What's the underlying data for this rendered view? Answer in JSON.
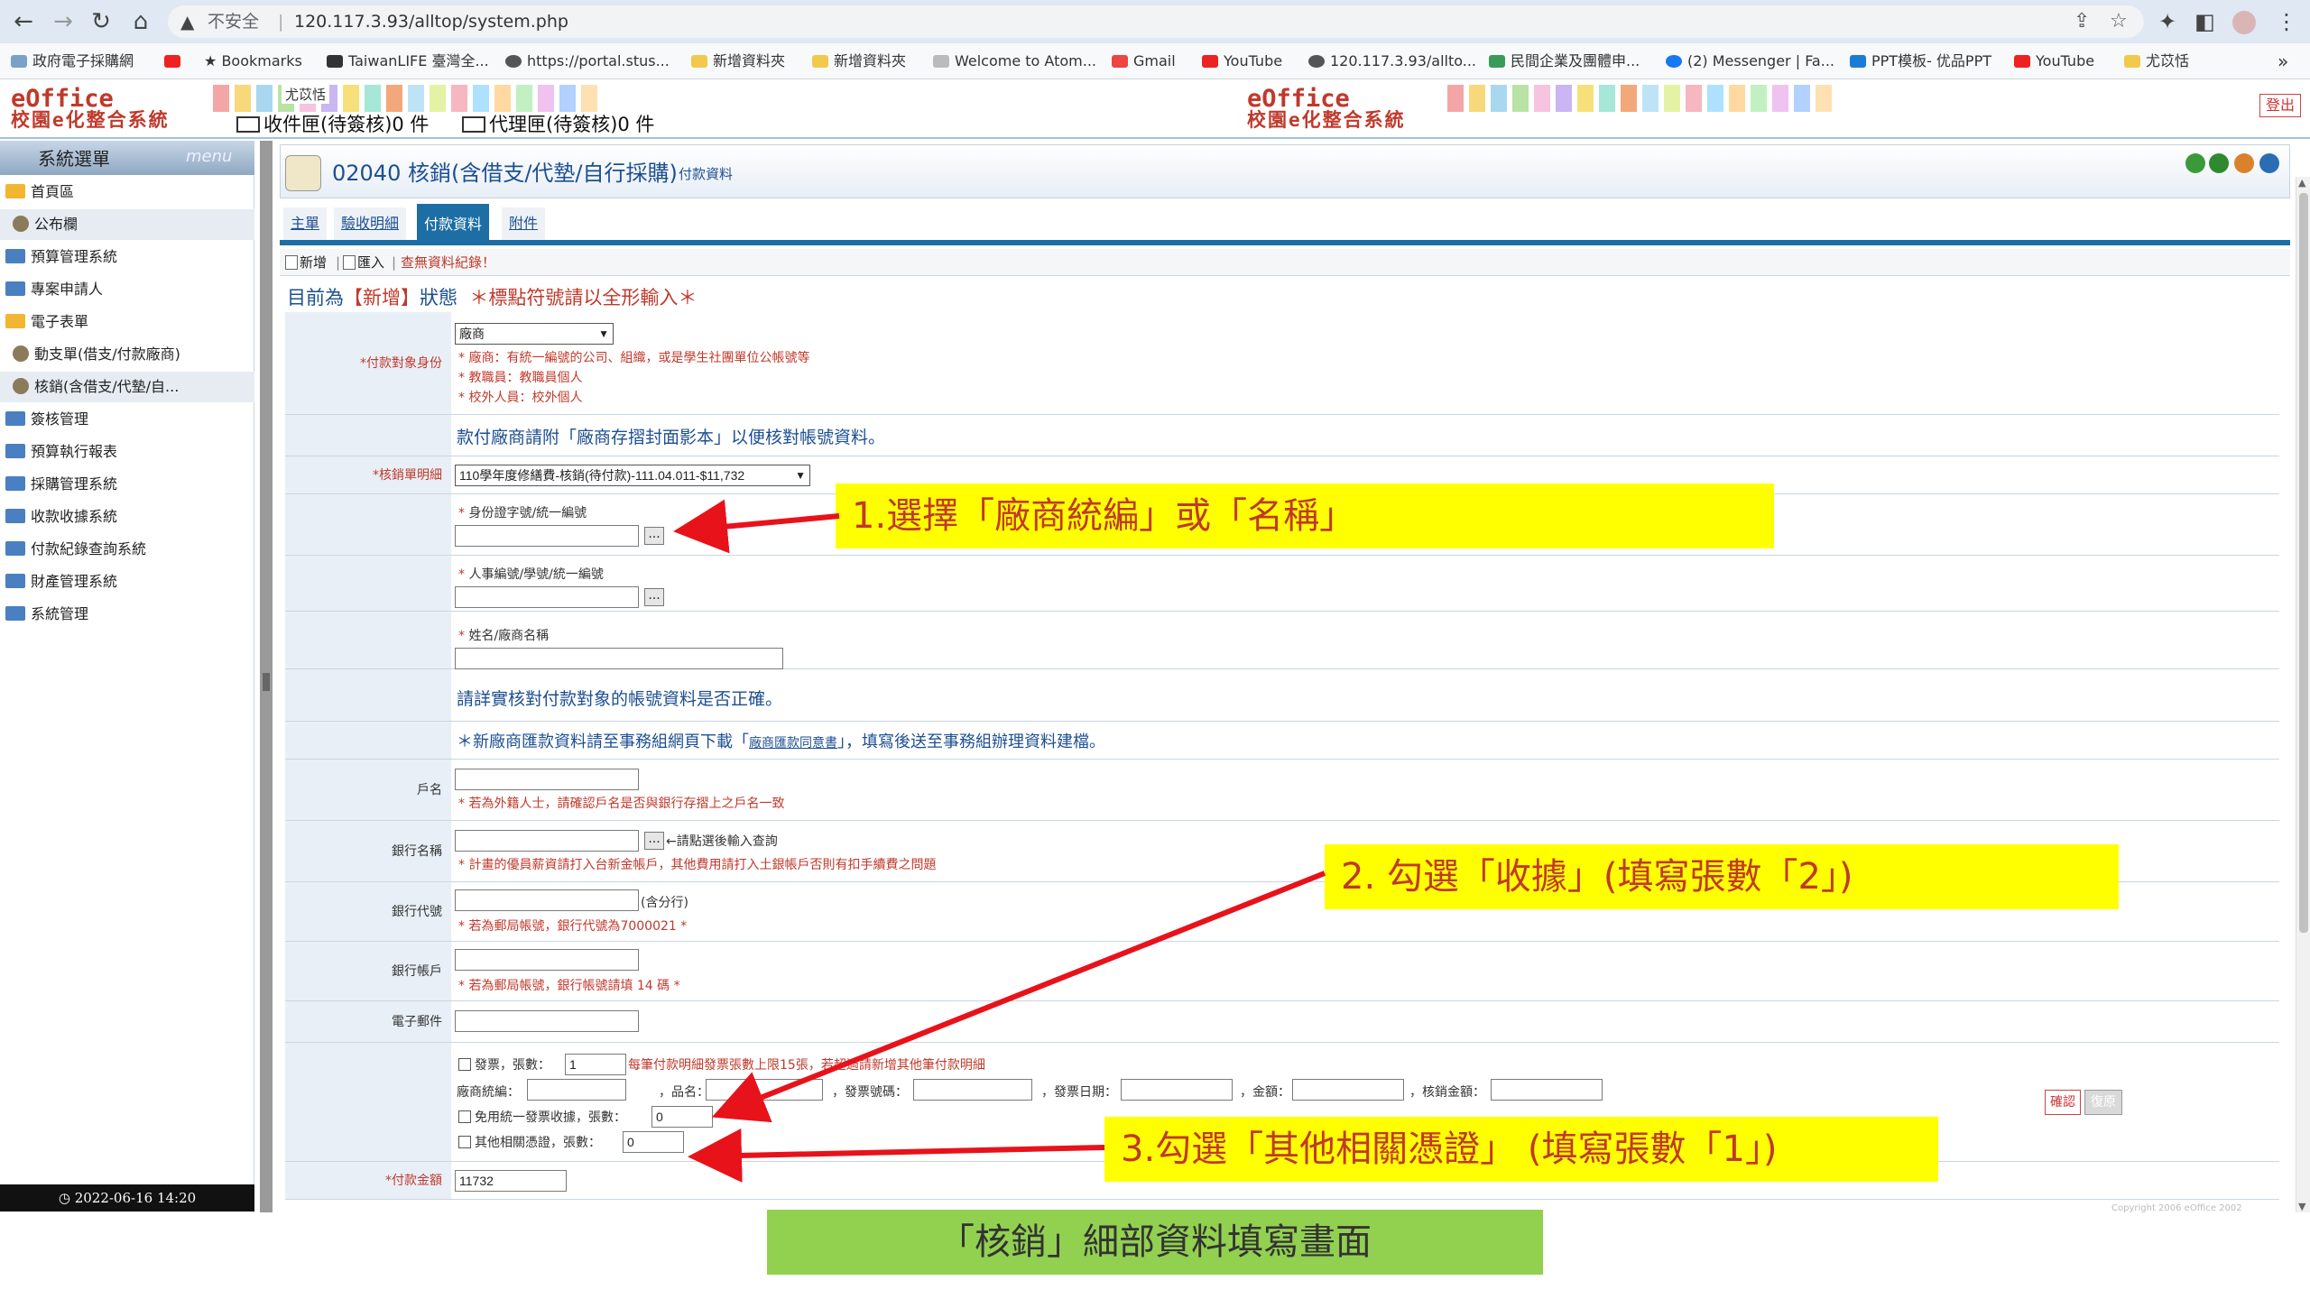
{
  "browser": {
    "insecure_label": "不安全",
    "url": "120.117.3.93/alltop/system.php",
    "bookmarks": [
      "政府電子採購網",
      "Bookmarks",
      "TaiwanLIFE 臺灣全...",
      "https://portal.stus...",
      "新增資料夾",
      "新增資料夾",
      "Welcome to Atom...",
      "Gmail",
      "YouTube",
      "120.117.3.93/allto...",
      "民間企業及團體申...",
      "(2) Messenger | Fa...",
      "PPT模板- 优品PPT",
      "YouTube",
      "尤苡恬"
    ],
    "bookmarks_more": "»"
  },
  "header": {
    "logo_text": "eOffice",
    "logo_sub": "校園e化整合系統",
    "user_name": "尤苡恬",
    "inbox_label": "收件匣(待簽核)0 件",
    "proxy_label": "代理匣(待簽核)0 件",
    "logout_label": "登出",
    "colors": [
      "#f4a6a6",
      "#f7d87a",
      "#a9d7f0",
      "#b9e3a5",
      "#f7c4e0",
      "#c9b6f2",
      "#f7e07a",
      "#a6e7d8",
      "#f3a87c",
      "#bfe3f6",
      "#e4f2a6",
      "#f6b7c1",
      "#aee0ff",
      "#ffd9a0",
      "#c2f0c2",
      "#f0c2f0",
      "#b3d1ff",
      "#ffe0b3"
    ]
  },
  "sidebar": {
    "title": "系統選單",
    "menu_tab": "menu",
    "items": [
      {
        "label": "首頁區",
        "type": "folder-open"
      },
      {
        "label": "公布欄",
        "type": "sub",
        "active": true
      },
      {
        "label": "預算管理系統",
        "type": "folder"
      },
      {
        "label": "專案申請人",
        "type": "folder"
      },
      {
        "label": "電子表單",
        "type": "folder-open"
      },
      {
        "label": "動支單(借支/付款廠商)",
        "type": "sub"
      },
      {
        "label": "核銷(含借支/代墊/自...",
        "type": "sub",
        "active": true
      },
      {
        "label": "簽核管理",
        "type": "folder"
      },
      {
        "label": "預算執行報表",
        "type": "folder"
      },
      {
        "label": "採購管理系統",
        "type": "folder"
      },
      {
        "label": "收款收據系統",
        "type": "folder"
      },
      {
        "label": "付款紀錄查詢系統",
        "type": "folder"
      },
      {
        "label": "財產管理系統",
        "type": "folder"
      },
      {
        "label": "系統管理",
        "type": "folder"
      }
    ],
    "clock": "2022-06-16 14:20"
  },
  "page": {
    "title": "02040 核銷(含借支/代墊/自行採購)",
    "subtitle": "付款資料",
    "tabs": [
      "主單",
      "驗收明細",
      "付款資料",
      "附件"
    ],
    "active_tab": 2,
    "toolbar": {
      "new": "新增",
      "import": "匯入",
      "no_record": "查無資料紀錄！"
    },
    "state_prefix": "目前為",
    "state_value": "【新增】",
    "state_suffix": "狀態",
    "state_note": "＊標點符號請以全形輸入＊"
  },
  "form": {
    "payee_type": {
      "label": "付款對象身份",
      "value": "廠商",
      "notes": [
        "* 廠商：有統一編號的公司、組織，或是學生社團單位公帳號等",
        "* 教職員：教職員個人",
        "* 校外人員：校外個人"
      ]
    },
    "vendor_hint": "款付廠商請附「廠商存摺封面影本」以便核對帳號資料。",
    "detail": {
      "label": "核銷單明細",
      "value": "110學年度修繕費-核銷(待付款)-111.04.011-$11,732"
    },
    "id_label": "身份證字號/統一編號",
    "staff_label": "人事編號/學號/統一編號",
    "name_label": "姓名/廠商名稱",
    "verify_hint": "請詳實核對付款對象的帳號資料是否正確。",
    "new_vendor_hint_pre": "＊新廠商匯款資料請至事務組網頁下載「",
    "new_vendor_link": "廠商匯款同意書",
    "new_vendor_hint_post": "」，填寫後送至事務組辦理資料建檔。",
    "account_name": {
      "label": "戶名",
      "note": "* 若為外籍人士，請確認戶名是否與銀行存摺上之戶名一致"
    },
    "bank_name": {
      "label": "銀行名稱",
      "hint": "←請點選後輸入查詢",
      "note": "* 計畫的優員薪資請打入台新金帳戶，其他費用請打入土銀帳戶否則有扣手續費之問題"
    },
    "bank_code": {
      "label": "銀行代號",
      "suffix": "(含分行)",
      "note": "* 若為郵局帳號，銀行代號為7000021 *"
    },
    "bank_account": {
      "label": "銀行帳戶",
      "note": "* 若為郵局帳號，銀行帳號請填 14 碼 *"
    },
    "email": {
      "label": "電子郵件"
    },
    "invoice": {
      "invoice_label": "發票，張數：",
      "invoice_count": "1",
      "invoice_note": "每筆付款明細發票張數上限15張，若超過請新增其他筆付款明細",
      "fields": [
        "廠商統編：",
        "，品名：",
        "，發票號碼：",
        "，發票日期：",
        "，金額：",
        "，核銷金額："
      ],
      "receipt_label": "免用統一發票收據，張數：",
      "receipt_count": "0",
      "other_label": "其他相關憑證，張數：",
      "other_count": "0",
      "confirm": "確認",
      "restore": "復原"
    },
    "amount": {
      "label": "付款金額",
      "value": "11732"
    },
    "copyright": "Copyright 2006 eOffice 2002"
  },
  "annotations": {
    "step1": "1.選擇「廠商統編」或「名稱」",
    "step2": "2. 勾選「收據」(填寫張數「2」)",
    "step3": "3.勾選「其他相關憑證」 (填寫張數「1」)",
    "caption": "「核銷」細部資料填寫畫面",
    "arrow_color": "#e8121a",
    "callout_color": "#ffff00",
    "caption_color": "#92d050"
  }
}
